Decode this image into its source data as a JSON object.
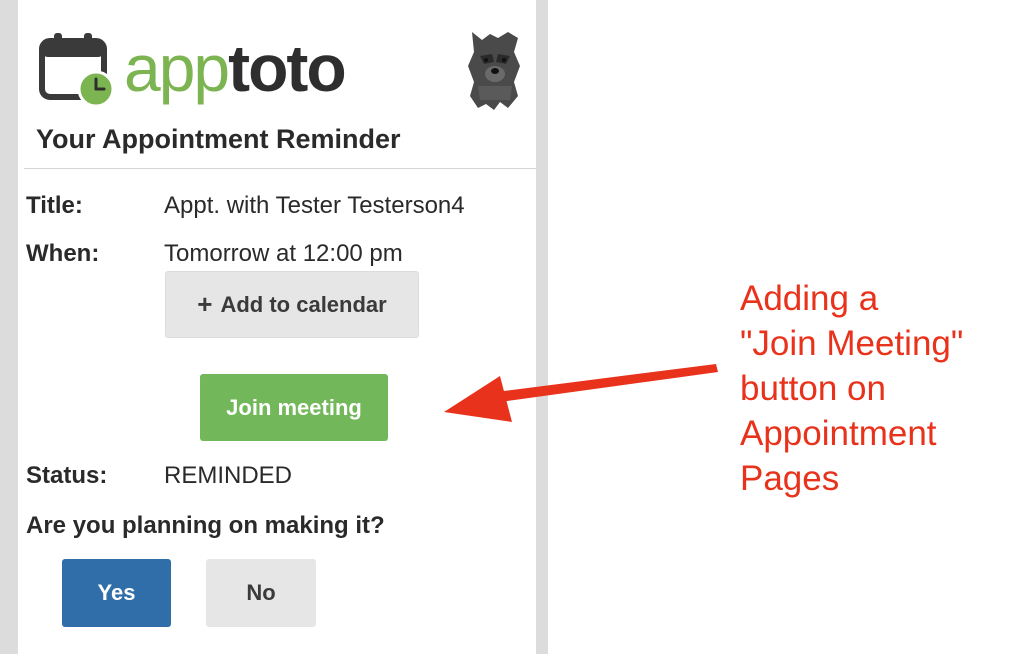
{
  "logo": {
    "text_app": "app",
    "text_toto": "toto",
    "icon": "calendar-clock-icon"
  },
  "mascot": {
    "icon": "terrier-dog-mascot-icon"
  },
  "header": {
    "title": "Your Appointment Reminder"
  },
  "details": {
    "title_label": "Title:",
    "title_value": "Appt. with Tester Testerson4",
    "when_label": "When:",
    "when_value": "Tomorrow at 12:00 pm",
    "status_label": "Status:",
    "status_value": "REMINDED"
  },
  "buttons": {
    "add_to_calendar": "Add to calendar",
    "add_icon": "plus-icon",
    "join_meeting": "Join meeting",
    "yes": "Yes",
    "no": "No"
  },
  "question": "Are you planning on making it?",
  "annotation": {
    "lines": [
      "Adding a",
      "\"Join Meeting\"",
      "button on",
      "Appointment",
      "Pages"
    ],
    "arrow_icon": "red-arrow-left"
  },
  "colors": {
    "brand_green": "#7cb451",
    "join_green": "#72b85a",
    "yes_blue": "#2f6ea8",
    "annotation_red": "#e8321b"
  }
}
